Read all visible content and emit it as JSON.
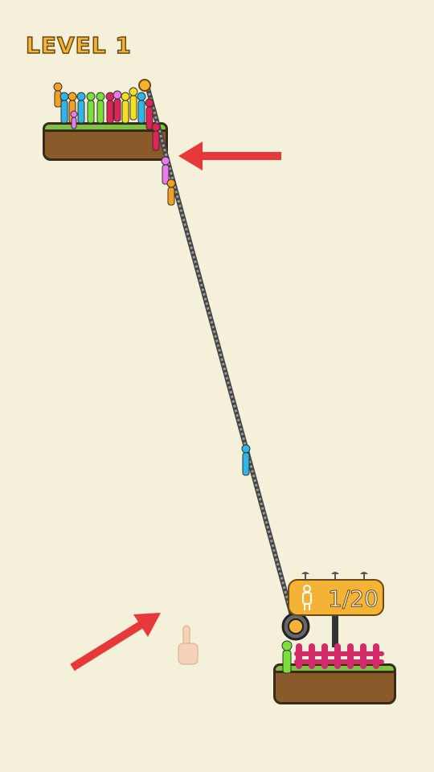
{
  "level": {
    "label": "LEVEL 1"
  },
  "counter": {
    "text": "1/20",
    "rescued": 1,
    "total": 20
  },
  "colors": {
    "background": "#f4f0d9",
    "accent": "#f5b335",
    "arrow": "#e8393a",
    "rope": "#7a7a7a",
    "grass": "#7dc243",
    "dirt": "#8a5a2b",
    "fence": "#d42a6a"
  },
  "icons": {
    "person": "person-icon",
    "arrow": "arrow-icon",
    "hand": "tap-hand-icon",
    "pulley": "pulley-icon"
  }
}
